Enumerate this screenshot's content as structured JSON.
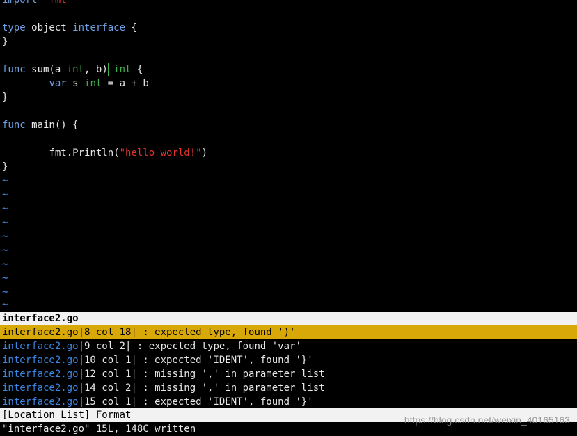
{
  "editor": {
    "import_kw": "import",
    "import_pkg": "\"fmt\"",
    "line_type": {
      "kw": "type",
      "name": " object ",
      "iface": "interface",
      "rest": " {"
    },
    "line_close1": "}",
    "line_func_sum": {
      "kw": "func",
      "sig1": " sum(a ",
      "int1": "int",
      "sig2": ", b)",
      "cursor_char": " ",
      "int2": "int",
      "rest": " {"
    },
    "line_var": {
      "indent": "        ",
      "kw": "var",
      "name": " s ",
      "type": "int",
      "rest": " = a + b"
    },
    "line_close2": "}",
    "line_func_main": {
      "kw": "func",
      "rest": " main() {"
    },
    "line_println": {
      "indent": "        ",
      "call": "fmt.Println(",
      "str": "\"hello world!\"",
      "rest": ")"
    },
    "line_close3": "}",
    "tilde": "~"
  },
  "location_list": {
    "title": "interface2.go",
    "items": [
      {
        "file": "interface2.go",
        "pos": "|8 col 18|",
        "msg": " : expected type, found ')'"
      },
      {
        "file": "interface2.go",
        "pos": "|9 col 2|",
        "msg": " : expected type, found 'var'"
      },
      {
        "file": "interface2.go",
        "pos": "|10 col 1|",
        "msg": " : expected 'IDENT', found '}'"
      },
      {
        "file": "interface2.go",
        "pos": "|12 col 1|",
        "msg": " : missing ',' in parameter list"
      },
      {
        "file": "interface2.go",
        "pos": "|14 col 2|",
        "msg": " : missing ',' in parameter list"
      },
      {
        "file": "interface2.go",
        "pos": "|15 col 1|",
        "msg": " : expected 'IDENT', found '}'"
      }
    ],
    "selected_index": 0
  },
  "status_bar": {
    "text": "[Location List] Format"
  },
  "command_line": {
    "text": "\"interface2.go\" 15L, 148C written"
  },
  "watermark": {
    "text": "https://blog.csdn.net/weixin_40165163"
  },
  "colors": {
    "background": "#000000",
    "keyword": "#6f9fe0",
    "type": "#3fae4f",
    "string": "#e0362e",
    "selection": "#d7a808",
    "filename": "#3a86e0"
  }
}
